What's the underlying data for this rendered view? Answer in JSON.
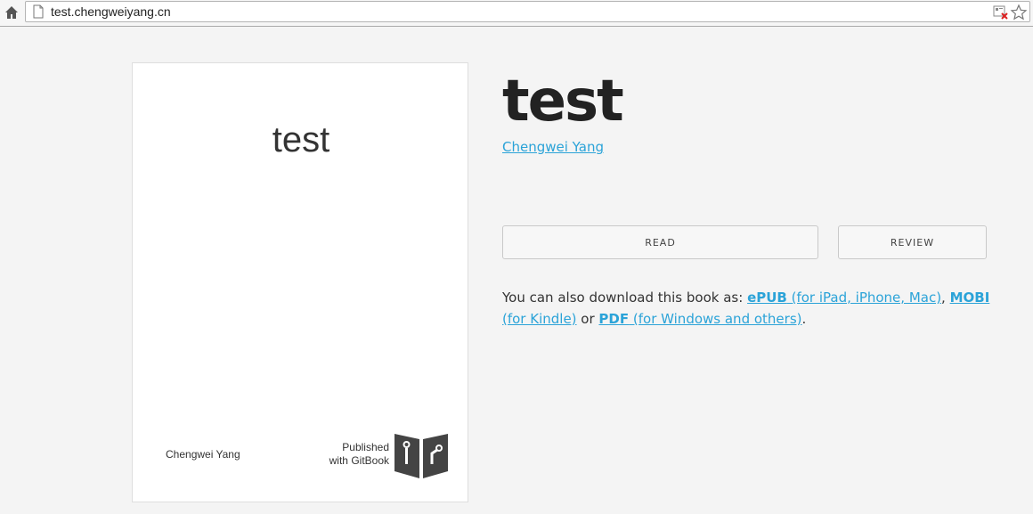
{
  "browser": {
    "url": "test.chengweiyang.cn"
  },
  "cover": {
    "title": "test",
    "author": "Chengwei Yang",
    "published_line1": "Published",
    "published_line2": "with GitBook"
  },
  "book": {
    "title": "test",
    "author": "Chengwei Yang"
  },
  "actions": {
    "read_label": "READ",
    "review_label": "REVIEW"
  },
  "download": {
    "prefix": "You can also download this book as: ",
    "epub_name": "ePUB",
    "epub_note": " (for iPad, iPhone, Mac)",
    "sep1": ", ",
    "mobi_name": "MOBI",
    "mobi_note": " (for Kindle)",
    "sep2": " or ",
    "pdf_name": "PDF",
    "pdf_note": " (for Windows and others)",
    "suffix": "."
  },
  "colors": {
    "link": "#2ba3d8",
    "background": "#f4f4f4",
    "title": "#222222"
  },
  "icons": [
    "home-icon",
    "page-icon",
    "blocked-content-icon",
    "star-icon",
    "gitbook-logo"
  ]
}
